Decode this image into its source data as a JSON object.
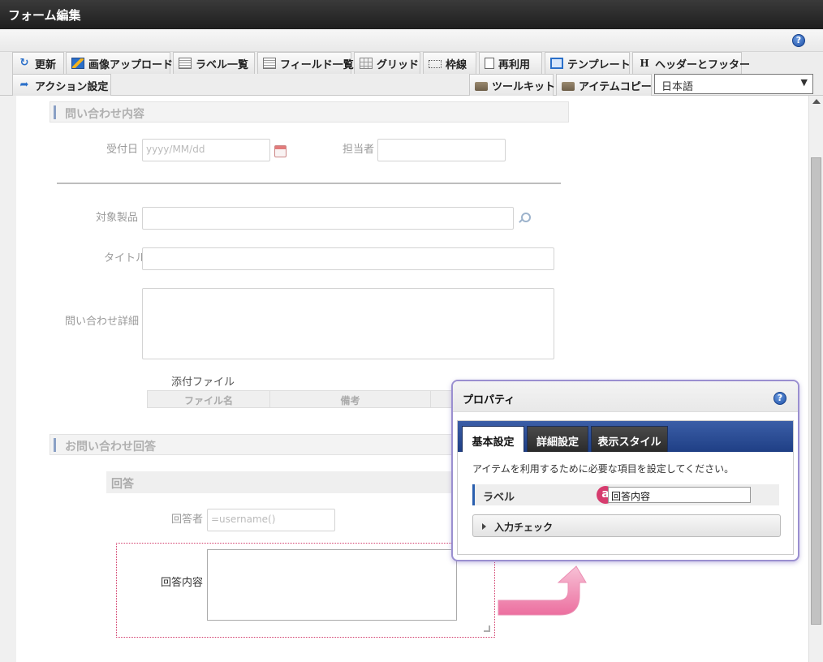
{
  "window": {
    "title": "フォーム編集"
  },
  "toolbar": {
    "row1": [
      {
        "label": "更新",
        "icon": "update-icon"
      },
      {
        "label": "画像アップロード",
        "icon": "image-upload-icon"
      },
      {
        "label": "ラベル一覧",
        "icon": "label-list-icon"
      },
      {
        "label": "フィールド一覧",
        "icon": "field-list-icon"
      },
      {
        "label": "グリッド",
        "icon": "grid-icon"
      },
      {
        "label": "枠線",
        "icon": "border-icon"
      },
      {
        "label": "再利用",
        "icon": "reuse-icon"
      },
      {
        "label": "テンプレート",
        "icon": "template-icon"
      },
      {
        "label": "ヘッダーとフッター",
        "icon": "header-footer-icon"
      }
    ],
    "action_label": "アクション設定",
    "toolkit_label": "ツールキット",
    "item_copy_label": "アイテムコピー",
    "language": "日本語"
  },
  "form": {
    "section1_title": "問い合わせ内容",
    "received_date_label": "受付日",
    "received_date_placeholder": "yyyy/MM/dd",
    "assignee_label": "担当者",
    "product_label": "対象製品",
    "title_label": "タイトル",
    "detail_label": "問い合わせ詳細",
    "attachment_label": "添付ファイル",
    "attachment_columns": [
      "ファイル名",
      "備考"
    ],
    "section2_title": "お問い合わせ回答",
    "answer_group_title": "回答",
    "responder_label": "回答者",
    "responder_value": "=username()",
    "answer_content_label": "回答内容"
  },
  "properties_dialog": {
    "title": "プロパティ",
    "tabs": [
      "基本設定",
      "詳細設定",
      "表示スタイル"
    ],
    "active_tab": "基本設定",
    "description": "アイテムを利用するために必要な項目を設定してください。",
    "label_field_label": "ラベル",
    "label_field_value": "回答内容",
    "badge": "a",
    "input_check_label": "入力チェック"
  },
  "colors": {
    "accent": "#d63c6e",
    "tab_bar": "#2a4c95",
    "title_bar": "#2b2b2b"
  }
}
